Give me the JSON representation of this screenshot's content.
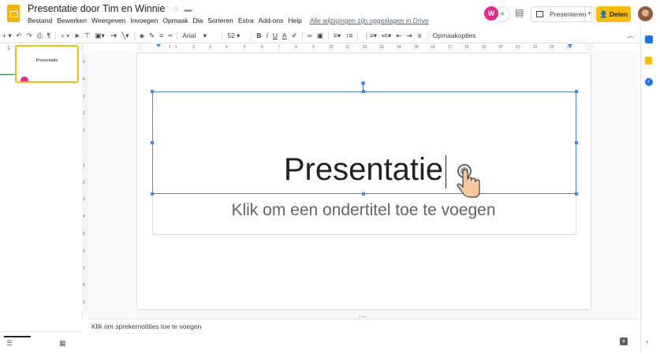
{
  "header": {
    "title": "Presentatie door Tim en Winnie",
    "star_icon": "star-icon",
    "folder_icon": "folder-icon",
    "menu": [
      "Bestand",
      "Bewerken",
      "Weergeven",
      "Invoegen",
      "Opmaak",
      "Dia",
      "Sorteren",
      "Extra",
      "Add-ons",
      "Help"
    ],
    "saved_status": "Alle wijzigingen zijn opgeslagen in Drive",
    "avatar_initial": "W",
    "present_label": "Presenteren",
    "share_label": "Delen"
  },
  "toolbar": {
    "font": "Arial",
    "size": "52",
    "bold": "B",
    "italic": "I",
    "underline": "U",
    "text_color": "A",
    "format_options": "Opmaakopties"
  },
  "ruler": {
    "ticks": [
      "1",
      "1",
      "2",
      "3",
      "4",
      "5",
      "6",
      "7",
      "8",
      "9",
      "10",
      "11",
      "12",
      "13",
      "14",
      "15",
      "16",
      "17",
      "18",
      "19",
      "20",
      "21",
      "22",
      "23",
      "24"
    ]
  },
  "vruler": {
    "ticks": [
      "5",
      "4",
      "3",
      "2",
      "1",
      "1",
      "2",
      "3",
      "4",
      "5",
      "6",
      "7",
      "8",
      "9"
    ]
  },
  "filmstrip": {
    "slide_number": "1",
    "thumb_title": "Presentatie"
  },
  "slide": {
    "title": "Presentatie",
    "subtitle_placeholder": "Klik om een ondertitel toe te voegen"
  },
  "notes": {
    "placeholder": "Klik om sprekernotities toe te voegen"
  },
  "colors": {
    "accent": "#fbbc04",
    "selection": "#4285f4",
    "avatar": "#e8288c"
  }
}
